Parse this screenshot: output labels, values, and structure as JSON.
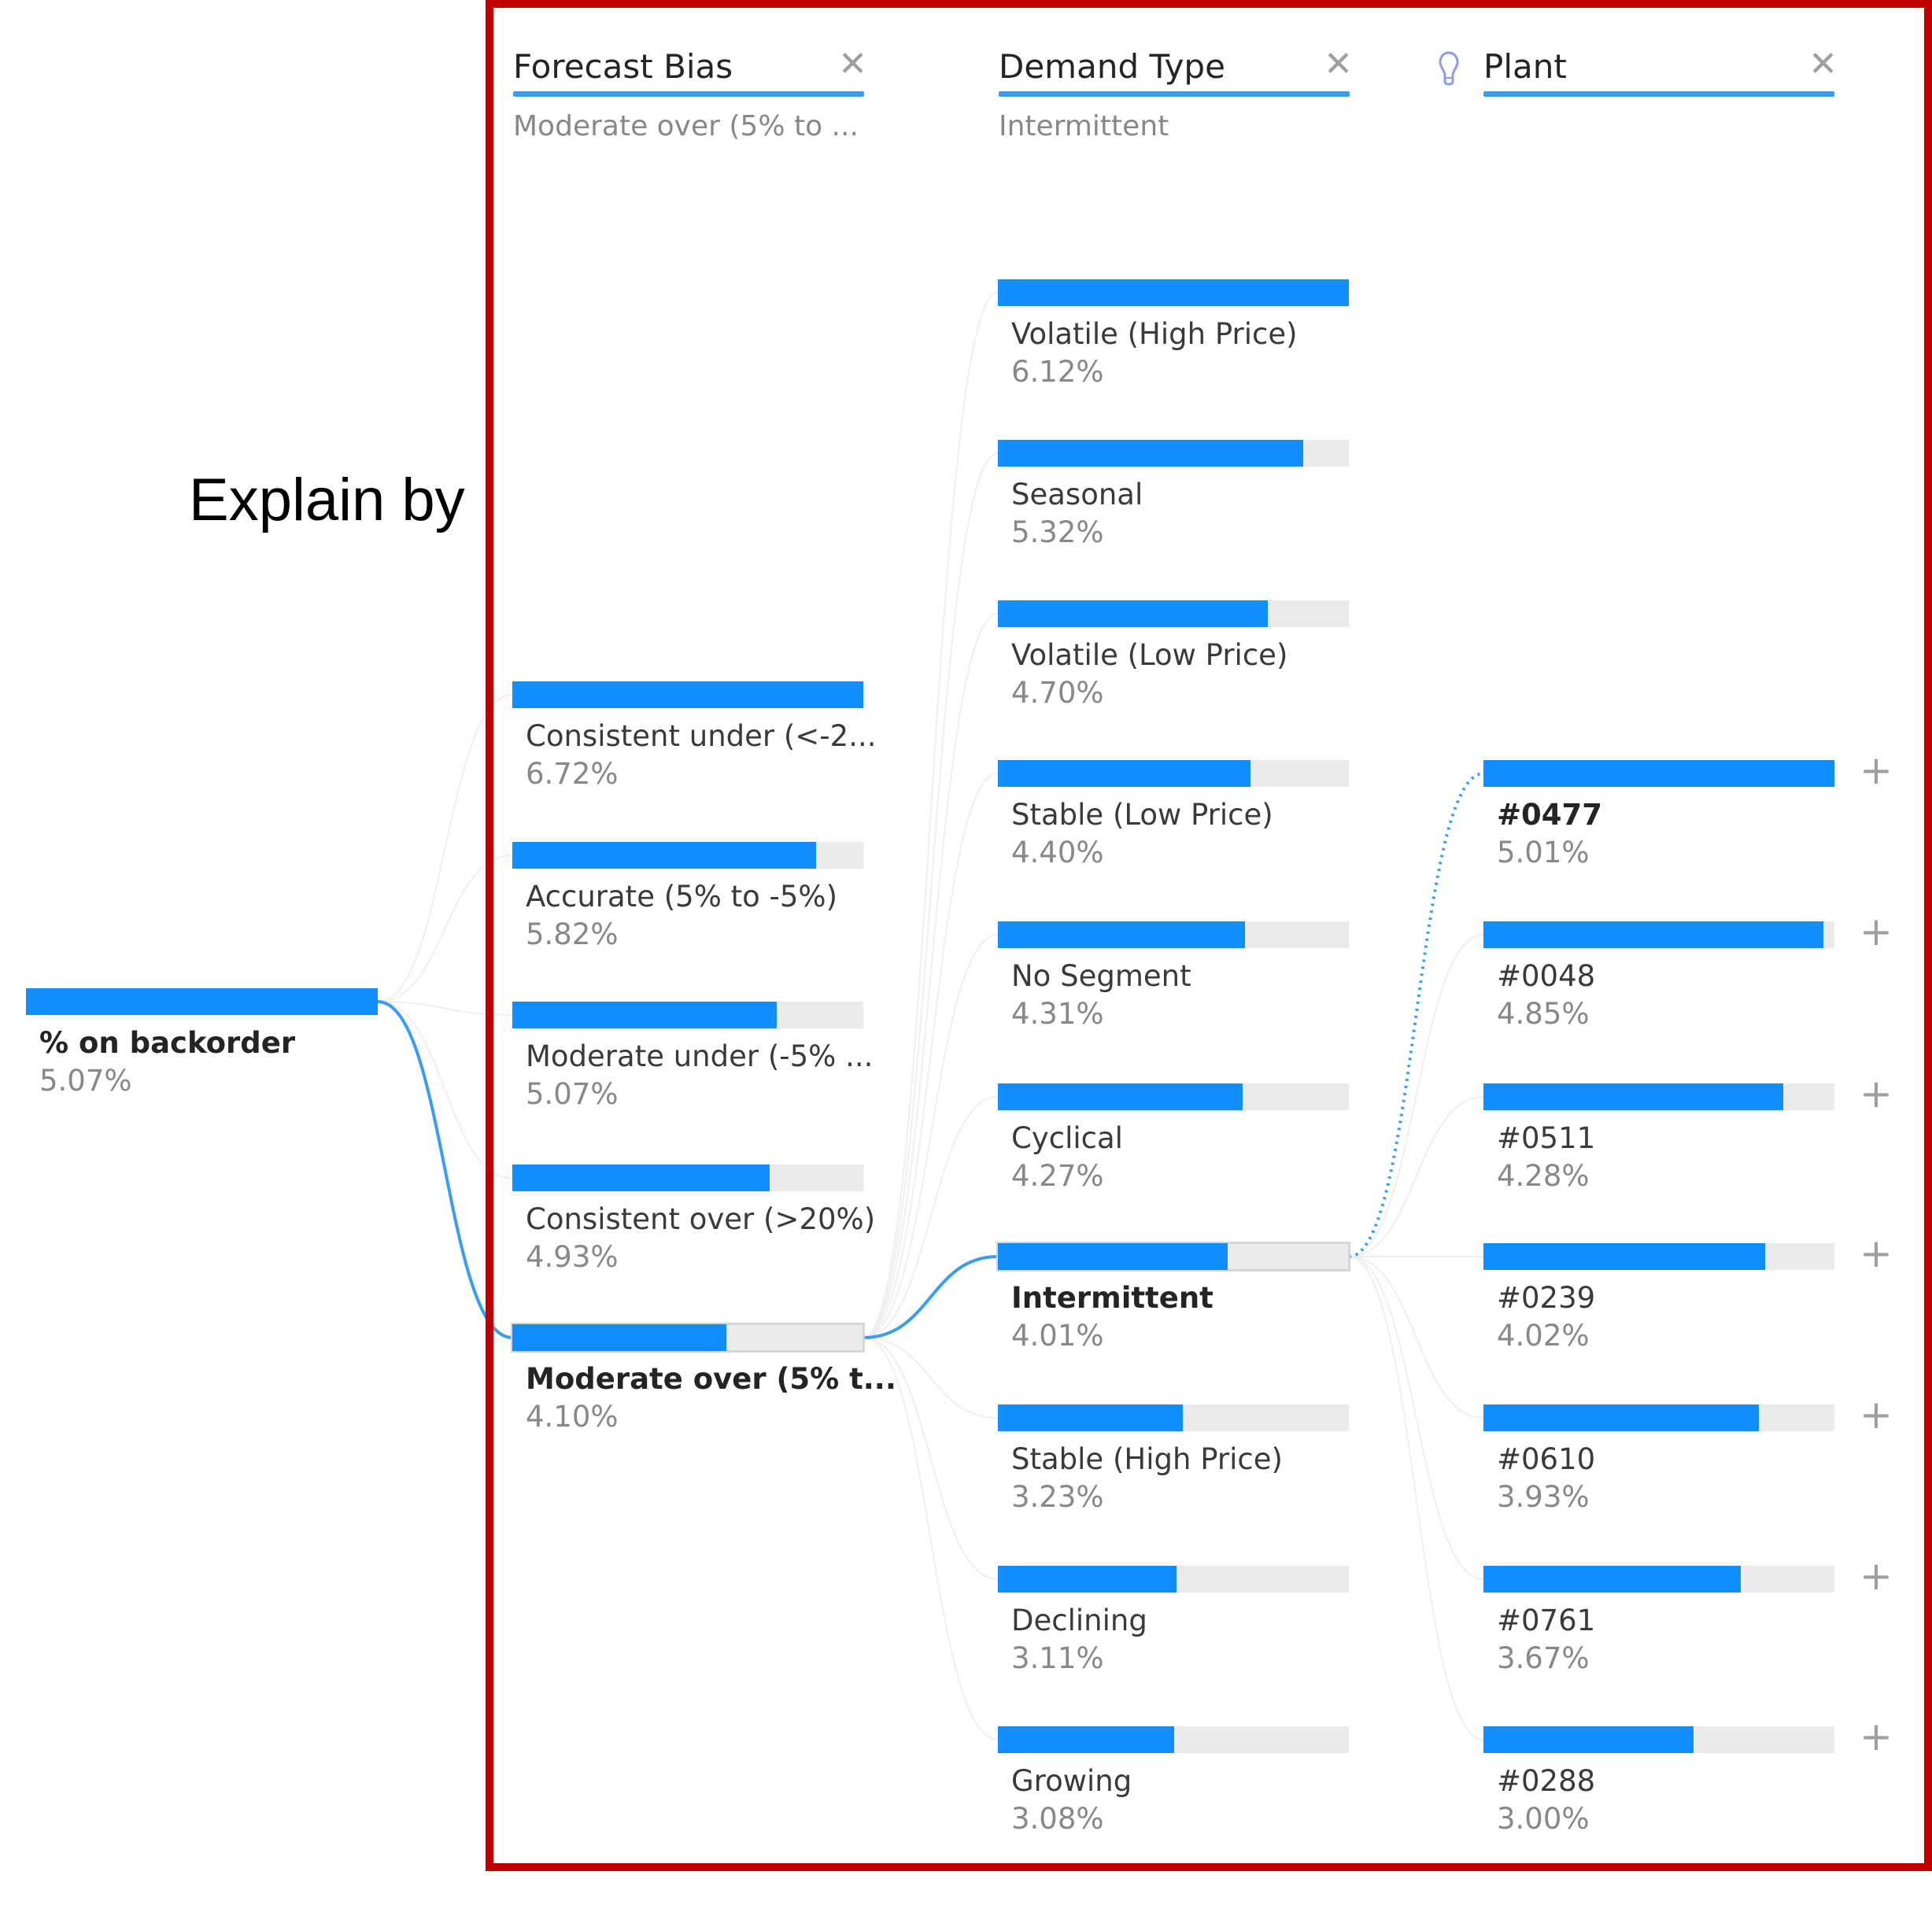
{
  "annotation": {
    "explain_by_label": "Explain by"
  },
  "colors": {
    "bar": "#118dff",
    "track": "#ebebeb",
    "frame": "#c00000",
    "selected_link": "#3a9cf5"
  },
  "root": {
    "label": "% on backorder",
    "value": "5.07%"
  },
  "columns": [
    {
      "title": "Forecast Bias",
      "selected": "Moderate over (5% to ...",
      "icon": "close-icon",
      "ai_level": false
    },
    {
      "title": "Demand Type",
      "selected": "Intermittent",
      "icon": "close-icon",
      "ai_level": false
    },
    {
      "title": "Plant",
      "selected": "",
      "icon": "close-icon",
      "ai_level": true,
      "ai_icon": "lightbulb-icon"
    }
  ],
  "chart_data": {
    "type": "decomposition-tree",
    "measure": "% on backorder",
    "root_value": 5.07,
    "levels": [
      {
        "name": "Forecast Bias",
        "selected": "Moderate over (5% t...",
        "nodes": [
          {
            "label": "Consistent under (<-2...",
            "value": 6.72,
            "display": "6.72%"
          },
          {
            "label": "Accurate (5% to -5%)",
            "value": 5.82,
            "display": "5.82%"
          },
          {
            "label": "Moderate under (-5% ...",
            "value": 5.07,
            "display": "5.07%"
          },
          {
            "label": "Consistent over (>20%)",
            "value": 4.93,
            "display": "4.93%"
          },
          {
            "label": "Moderate over (5% t...",
            "value": 4.1,
            "display": "4.10%",
            "selected": true
          }
        ]
      },
      {
        "name": "Demand Type",
        "selected": "Intermittent",
        "nodes": [
          {
            "label": "Volatile (High Price)",
            "value": 6.12,
            "display": "6.12%"
          },
          {
            "label": "Seasonal",
            "value": 5.32,
            "display": "5.32%"
          },
          {
            "label": "Volatile (Low Price)",
            "value": 4.7,
            "display": "4.70%"
          },
          {
            "label": "Stable (Low Price)",
            "value": 4.4,
            "display": "4.40%"
          },
          {
            "label": "No Segment",
            "value": 4.31,
            "display": "4.31%"
          },
          {
            "label": "Cyclical",
            "value": 4.27,
            "display": "4.27%"
          },
          {
            "label": "Intermittent",
            "value": 4.01,
            "display": "4.01%",
            "selected": true
          },
          {
            "label": "Stable (High Price)",
            "value": 3.23,
            "display": "3.23%"
          },
          {
            "label": "Declining",
            "value": 3.11,
            "display": "3.11%"
          },
          {
            "label": "Growing",
            "value": 3.08,
            "display": "3.08%"
          }
        ]
      },
      {
        "name": "Plant",
        "ai_split": "high value",
        "nodes": [
          {
            "label": "#0477",
            "value": 5.01,
            "display": "5.01%",
            "highlighted": true
          },
          {
            "label": "#0048",
            "value": 4.85,
            "display": "4.85%"
          },
          {
            "label": "#0511",
            "value": 4.28,
            "display": "4.28%"
          },
          {
            "label": "#0239",
            "value": 4.02,
            "display": "4.02%"
          },
          {
            "label": "#0610",
            "value": 3.93,
            "display": "3.93%"
          },
          {
            "label": "#0761",
            "value": 3.67,
            "display": "3.67%"
          },
          {
            "label": "#0288",
            "value": 3.0,
            "display": "3.00%"
          }
        ]
      }
    ]
  }
}
